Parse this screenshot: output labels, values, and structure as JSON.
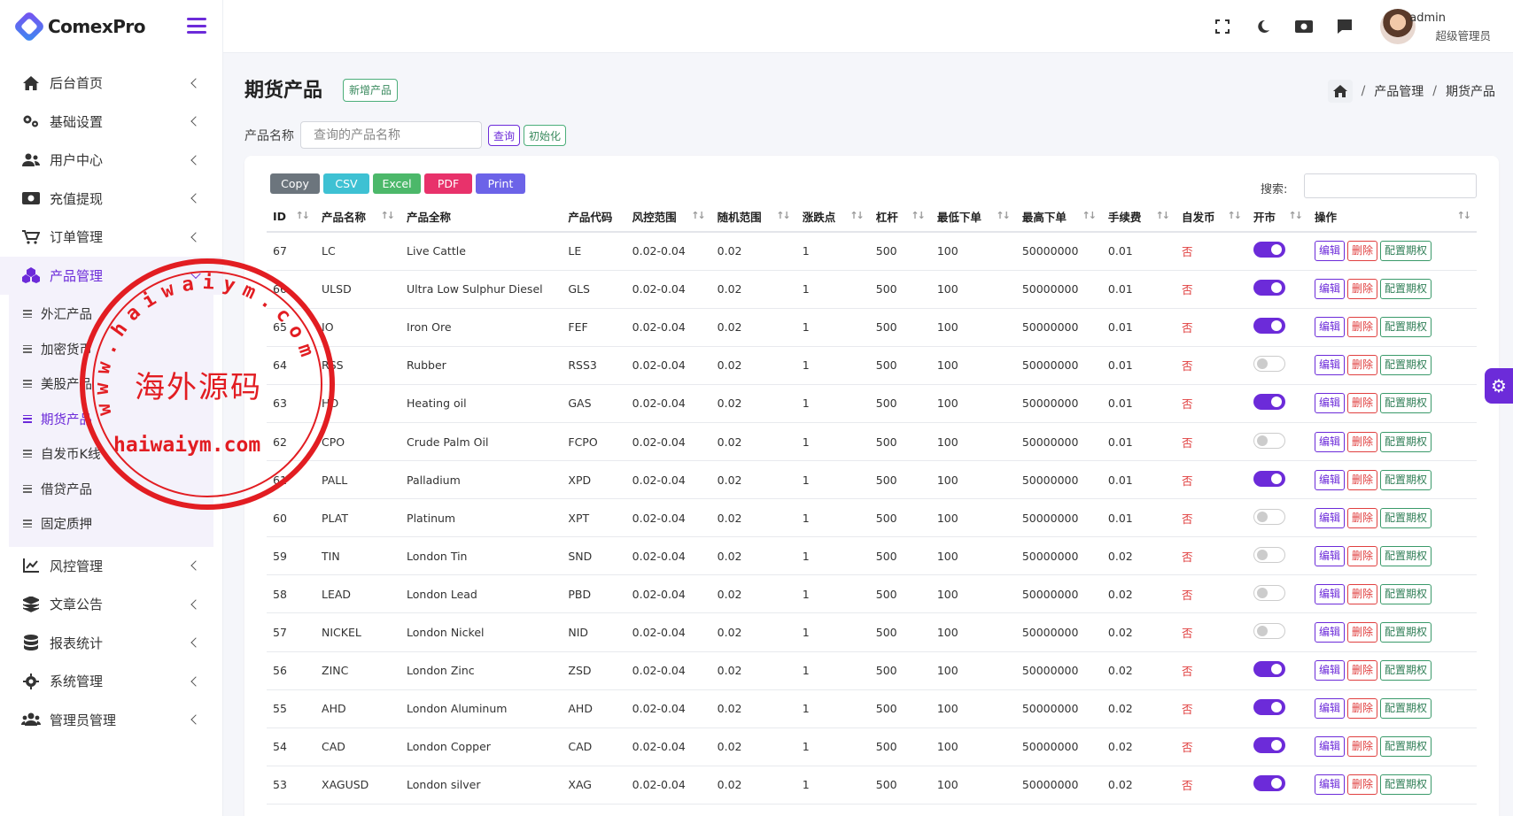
{
  "brand": {
    "name": "ComexPro"
  },
  "sidebar": {
    "items": [
      {
        "label": "后台首页",
        "icon": "home-icon"
      },
      {
        "label": "基础设置",
        "icon": "gears-icon"
      },
      {
        "label": "用户中心",
        "icon": "users-icon"
      },
      {
        "label": "充值提现",
        "icon": "money-icon"
      },
      {
        "label": "订单管理",
        "icon": "cart-icon"
      },
      {
        "label": "产品管理",
        "icon": "cubes-icon",
        "active": true
      }
    ],
    "subitems": [
      {
        "label": "外汇产品"
      },
      {
        "label": "加密货币"
      },
      {
        "label": "美股产品"
      },
      {
        "label": "期货产品",
        "active": true
      },
      {
        "label": "自发币K线"
      },
      {
        "label": "借贷产品"
      },
      {
        "label": "固定质押"
      }
    ],
    "lower_items": [
      {
        "label": "风控管理",
        "icon": "chart-line-icon"
      },
      {
        "label": "文章公告",
        "icon": "layers-icon"
      },
      {
        "label": "报表统计",
        "icon": "database-icon"
      },
      {
        "label": "系统管理",
        "icon": "gear-icon"
      },
      {
        "label": "管理员管理",
        "icon": "users-group-icon"
      }
    ]
  },
  "header": {
    "user_name": "admin",
    "user_role": "超级管理员"
  },
  "page": {
    "title": "期货产品",
    "add_button": "新增产品",
    "breadcrumb": [
      "产品管理",
      "期货产品"
    ],
    "filter_label": "产品名称",
    "filter_placeholder": "查询的产品名称",
    "query_button": "查询",
    "reset_button": "初始化"
  },
  "toolbar": {
    "buttons": [
      {
        "label": "Copy",
        "color": "#6c757d"
      },
      {
        "label": "CSV",
        "color": "#3ec1d3"
      },
      {
        "label": "Excel",
        "color": "#4cb86a"
      },
      {
        "label": "PDF",
        "color": "#e8326b"
      },
      {
        "label": "Print",
        "color": "#6c63e8"
      }
    ],
    "search_label": "搜索:"
  },
  "table": {
    "columns": [
      "ID",
      "产品名称",
      "产品全称",
      "产品代码",
      "风控范围",
      "随机范围",
      "涨跌点",
      "杠杆",
      "最低下单",
      "最高下单",
      "手续费",
      "自发币",
      "开市",
      "操作"
    ],
    "actions": {
      "edit": "编辑",
      "delete": "删除",
      "perm": "配置期权"
    },
    "rows": [
      {
        "id": "67",
        "name": "LC",
        "full": "Live Cattle",
        "code": "LE",
        "risk": "0.02-0.04",
        "rand": "0.02",
        "pt": "1",
        "lev": "500",
        "min": "100",
        "max": "50000000",
        "fee": "0.01",
        "self": "否",
        "open": true
      },
      {
        "id": "66",
        "name": "ULSD",
        "full": "Ultra Low Sulphur Diesel",
        "code": "GLS",
        "risk": "0.02-0.04",
        "rand": "0.02",
        "pt": "1",
        "lev": "500",
        "min": "100",
        "max": "50000000",
        "fee": "0.01",
        "self": "否",
        "open": true
      },
      {
        "id": "65",
        "name": "IO",
        "full": "Iron Ore",
        "code": "FEF",
        "risk": "0.02-0.04",
        "rand": "0.02",
        "pt": "1",
        "lev": "500",
        "min": "100",
        "max": "50000000",
        "fee": "0.01",
        "self": "否",
        "open": true
      },
      {
        "id": "64",
        "name": "RSS",
        "full": "Rubber",
        "code": "RSS3",
        "risk": "0.02-0.04",
        "rand": "0.02",
        "pt": "1",
        "lev": "500",
        "min": "100",
        "max": "50000000",
        "fee": "0.01",
        "self": "否",
        "open": false
      },
      {
        "id": "63",
        "name": "HO",
        "full": "Heating oil",
        "code": "GAS",
        "risk": "0.02-0.04",
        "rand": "0.02",
        "pt": "1",
        "lev": "500",
        "min": "100",
        "max": "50000000",
        "fee": "0.01",
        "self": "否",
        "open": true
      },
      {
        "id": "62",
        "name": "CPO",
        "full": "Crude Palm Oil",
        "code": "FCPO",
        "risk": "0.02-0.04",
        "rand": "0.02",
        "pt": "1",
        "lev": "500",
        "min": "100",
        "max": "50000000",
        "fee": "0.01",
        "self": "否",
        "open": false
      },
      {
        "id": "61",
        "name": "PALL",
        "full": "Palladium",
        "code": "XPD",
        "risk": "0.02-0.04",
        "rand": "0.02",
        "pt": "1",
        "lev": "500",
        "min": "100",
        "max": "50000000",
        "fee": "0.01",
        "self": "否",
        "open": true
      },
      {
        "id": "60",
        "name": "PLAT",
        "full": "Platinum",
        "code": "XPT",
        "risk": "0.02-0.04",
        "rand": "0.02",
        "pt": "1",
        "lev": "500",
        "min": "100",
        "max": "50000000",
        "fee": "0.01",
        "self": "否",
        "open": false
      },
      {
        "id": "59",
        "name": "TIN",
        "full": "London Tin",
        "code": "SND",
        "risk": "0.02-0.04",
        "rand": "0.02",
        "pt": "1",
        "lev": "500",
        "min": "100",
        "max": "50000000",
        "fee": "0.02",
        "self": "否",
        "open": false
      },
      {
        "id": "58",
        "name": "LEAD",
        "full": "London Lead",
        "code": "PBD",
        "risk": "0.02-0.04",
        "rand": "0.02",
        "pt": "1",
        "lev": "500",
        "min": "100",
        "max": "50000000",
        "fee": "0.02",
        "self": "否",
        "open": false
      },
      {
        "id": "57",
        "name": "NICKEL",
        "full": "London Nickel",
        "code": "NID",
        "risk": "0.02-0.04",
        "rand": "0.02",
        "pt": "1",
        "lev": "500",
        "min": "100",
        "max": "50000000",
        "fee": "0.02",
        "self": "否",
        "open": false
      },
      {
        "id": "56",
        "name": "ZINC",
        "full": "London Zinc",
        "code": "ZSD",
        "risk": "0.02-0.04",
        "rand": "0.02",
        "pt": "1",
        "lev": "500",
        "min": "100",
        "max": "50000000",
        "fee": "0.02",
        "self": "否",
        "open": true
      },
      {
        "id": "55",
        "name": "AHD",
        "full": "London Aluminum",
        "code": "AHD",
        "risk": "0.02-0.04",
        "rand": "0.02",
        "pt": "1",
        "lev": "500",
        "min": "100",
        "max": "50000000",
        "fee": "0.02",
        "self": "否",
        "open": true
      },
      {
        "id": "54",
        "name": "CAD",
        "full": "London Copper",
        "code": "CAD",
        "risk": "0.02-0.04",
        "rand": "0.02",
        "pt": "1",
        "lev": "500",
        "min": "100",
        "max": "50000000",
        "fee": "0.02",
        "self": "否",
        "open": true
      },
      {
        "id": "53",
        "name": "XAGUSD",
        "full": "London silver",
        "code": "XAG",
        "risk": "0.02-0.04",
        "rand": "0.02",
        "pt": "1",
        "lev": "500",
        "min": "100",
        "max": "50000000",
        "fee": "0.02",
        "self": "否",
        "open": true
      }
    ]
  },
  "watermark": {
    "text": "海外源码",
    "url": "haiwaiym.com",
    "arc_text": "www.haiwaiym.com",
    "color": "#e21d22"
  }
}
